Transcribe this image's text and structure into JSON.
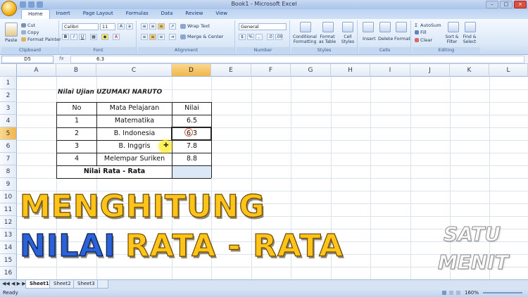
{
  "window": {
    "title": "Book1 - Microsoft Excel"
  },
  "ribbon_tabs": [
    "Home",
    "Insert",
    "Page Layout",
    "Formulas",
    "Data",
    "Review",
    "View"
  ],
  "ribbon": {
    "clipboard": {
      "paste": "Paste",
      "cut": "Cut",
      "copy": "Copy",
      "format_painter": "Format Painter",
      "label": "Clipboard"
    },
    "font": {
      "name": "Calibri",
      "size": "11",
      "label": "Font"
    },
    "alignment": {
      "wrap_text": "Wrap Text",
      "merge_center": "Merge & Center",
      "label": "Alignment"
    },
    "number": {
      "format": "General",
      "label": "Number"
    },
    "styles": {
      "conditional": "Conditional Formatting",
      "format_table": "Format as Table",
      "cell_styles": "Cell Styles",
      "label": "Styles"
    },
    "cells": {
      "insert": "Insert",
      "delete": "Delete",
      "format": "Format",
      "label": "Cells"
    },
    "editing": {
      "autosum": "AutoSum",
      "fill": "Fill",
      "clear": "Clear",
      "sort_filter": "Sort & Filter",
      "find_select": "Find & Select",
      "label": "Editing"
    }
  },
  "formula_bar": {
    "name_box": "D5",
    "fx": "fx",
    "value": "6.3"
  },
  "columns": [
    "A",
    "B",
    "C",
    "D",
    "E",
    "F",
    "G",
    "H",
    "I",
    "J",
    "K",
    "L"
  ],
  "rows": [
    "1",
    "2",
    "3",
    "4",
    "5",
    "6",
    "7",
    "8",
    "9",
    "10",
    "11",
    "12",
    "13",
    "14",
    "15",
    "16"
  ],
  "sheet": {
    "title": "Nilai Ujian UZUMAKI NARUTO",
    "headers": {
      "no": "No",
      "subject": "Mata Pelajaran",
      "score": "Nilai"
    },
    "data": [
      {
        "no": "1",
        "subject": "Matematika",
        "score": "6.5"
      },
      {
        "no": "2",
        "subject": "B. Indonesia",
        "score": "6.3"
      },
      {
        "no": "3",
        "subject": "B. Inggris",
        "score": "7.8"
      },
      {
        "no": "4",
        "subject": "Melempar Suriken",
        "score": "8.8"
      }
    ],
    "avg_label": "Nilai Rata - Rata"
  },
  "overlay": {
    "line1": "MENGHITUNG",
    "line2_blue": "NILAI",
    "line2_yellow": "RATA - RATA",
    "watermark1": "SATU",
    "watermark2": "MENIT"
  },
  "sheet_tabs": [
    "Sheet1",
    "Sheet2",
    "Sheet3"
  ],
  "status": {
    "ready": "Ready",
    "zoom": "160%"
  },
  "colors": {
    "yellow": "#ffc319",
    "blue": "#2a62d7",
    "selected_header": "#f1b64a"
  }
}
